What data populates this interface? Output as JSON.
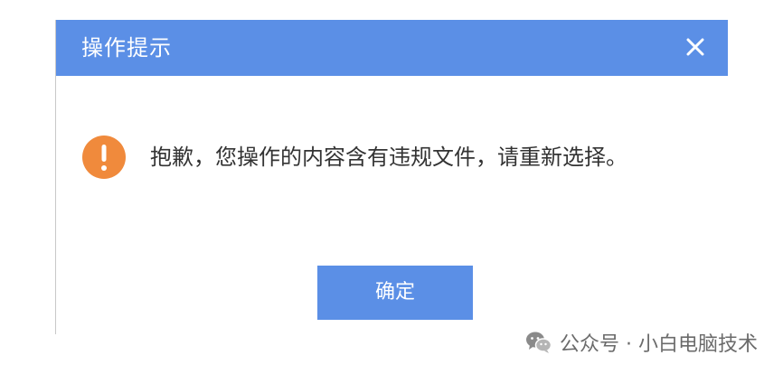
{
  "dialog": {
    "title": "操作提示",
    "message": "抱歉，您操作的内容含有违规文件，请重新选择。",
    "confirm_label": "确定"
  },
  "watermark": {
    "text": "公众号 · 小白电脑技术"
  },
  "icons": {
    "close": "close-icon",
    "warning": "exclamation-circle-icon",
    "wechat": "wechat-logo-icon"
  },
  "colors": {
    "titlebar": "#5b8fe6",
    "button": "#5b8fe6",
    "warning": "#f08a3c",
    "message_text": "#333333",
    "watermark_text": "#6b6b6b"
  }
}
